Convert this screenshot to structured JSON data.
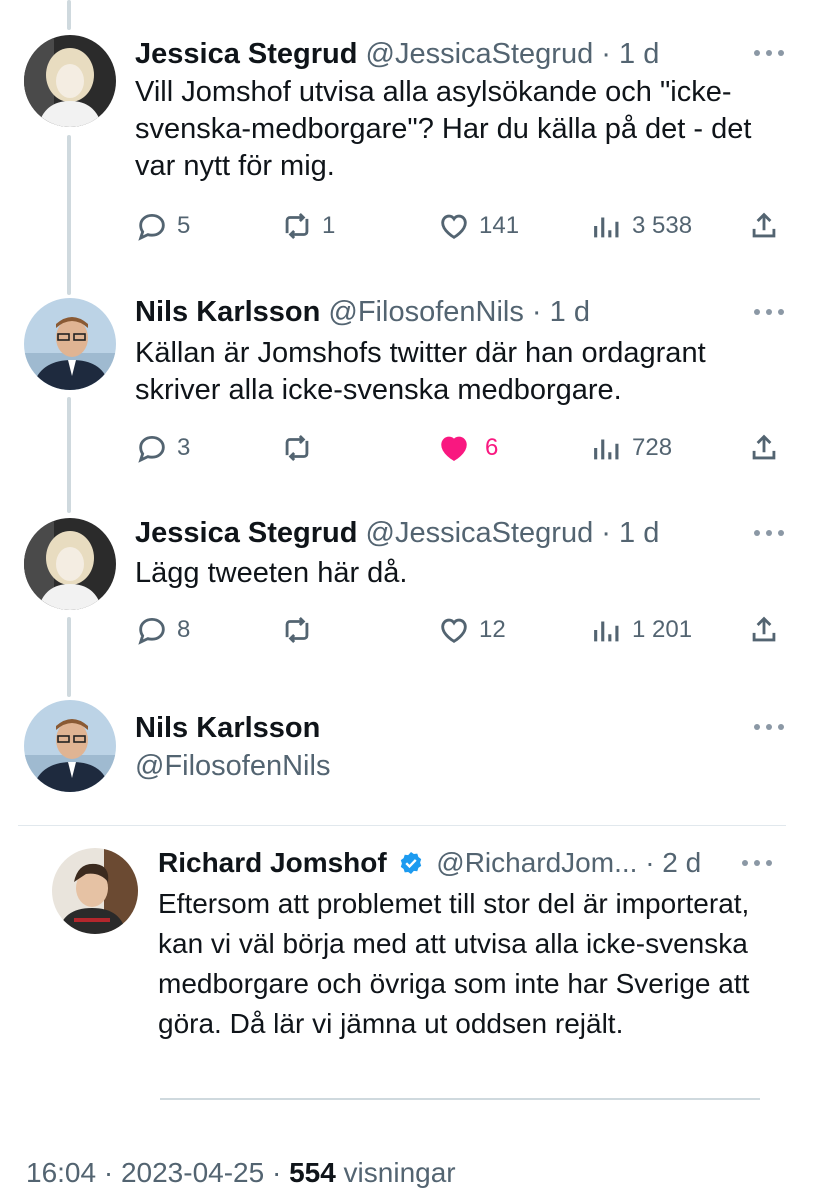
{
  "tweets": [
    {
      "name": "Jessica Stegrud",
      "handle": "@JessicaStegrud",
      "time": "· 1 d",
      "text": "Vill Jomshof utvisa alla asylsökande och \"icke-svenska-medborgare\"? Har du källa på det - det var nytt för mig.",
      "replies": "5",
      "retweets": "1",
      "likes": "141",
      "views": "3 538",
      "liked": false
    },
    {
      "name": "Nils Karlsson",
      "handle": "@FilosofenNils",
      "time": "· 1 d",
      "text": "Källan är Jomshofs twitter där han ordagrant skriver alla icke-svenska medborgare.",
      "replies": "3",
      "retweets": "",
      "likes": "6",
      "views": "728",
      "liked": true
    },
    {
      "name": "Jessica Stegrud",
      "handle": "@JessicaStegrud",
      "time": "· 1 d",
      "text": "Lägg tweeten här då.",
      "replies": "8",
      "retweets": "",
      "likes": "12",
      "views": "1 201",
      "liked": false
    }
  ],
  "main_tweet": {
    "name": "Nils Karlsson",
    "handle": "@FilosofenNils",
    "quoted": {
      "name": "Richard Jomshof",
      "handle": "@RichardJom...",
      "time": "· 2 d",
      "text": "Eftersom att problemet till stor del är importerat, kan vi väl börja med att utvisa alla icke-svenska medborgare och övriga som inte har Sverige att göra. Då lär vi jämna ut oddsen rejält."
    },
    "timestamp": "16:04 · 2023-04-25 · ",
    "views_count": "554",
    "views_label": " visningar"
  },
  "icons": {
    "reply": "reply-icon",
    "retweet": "retweet-icon",
    "like": "heart-icon",
    "views": "views-icon",
    "share": "share-icon",
    "more": "more-icon",
    "verified": "verified-badge-icon"
  },
  "colors": {
    "like_active": "#f91880",
    "verified": "#1d9bf0",
    "secondary_text": "#536471"
  }
}
